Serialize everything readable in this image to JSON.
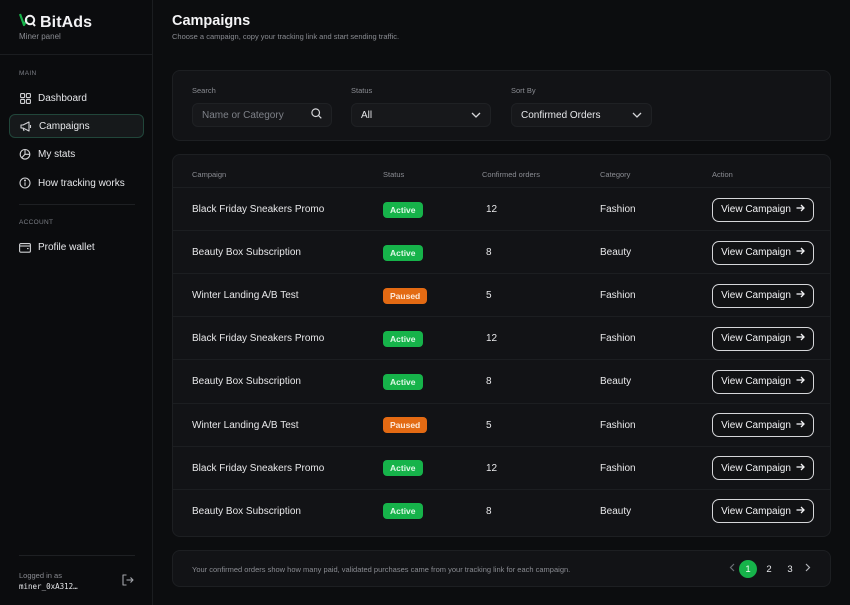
{
  "brand": {
    "name": "BitAds",
    "subtitle": "Miner panel"
  },
  "sidebar": {
    "main_label": "MAIN",
    "account_label": "ACCOUNT",
    "items": [
      {
        "label": "Dashboard",
        "icon": "grid-icon"
      },
      {
        "label": "Campaigns",
        "icon": "megaphone-icon",
        "active": true
      },
      {
        "label": "My stats",
        "icon": "pie-chart-icon"
      },
      {
        "label": "How tracking works",
        "icon": "info-icon"
      }
    ],
    "account_items": [
      {
        "label": "Profile wallet",
        "icon": "wallet-icon"
      }
    ],
    "logged_in_label": "Logged in as",
    "logged_in_user": "miner_0xA312…"
  },
  "page": {
    "title": "Campaigns",
    "subtitle": "Choose a campaign, copy your tracking link and start sending traffic."
  },
  "filters": {
    "search_label": "Search",
    "search_placeholder": "Name or Category",
    "status_label": "Status",
    "status_value": "All",
    "sort_label": "Sort By",
    "sort_value": "Confirmed Orders"
  },
  "table": {
    "headers": [
      "Campaign",
      "Status",
      "Confirmed orders",
      "Category",
      "Action"
    ],
    "rows": [
      {
        "campaign": "Black Friday Sneakers Promo",
        "status": "Active",
        "orders": "12",
        "category": "Fashion",
        "action": "View Campaign"
      },
      {
        "campaign": "Beauty Box Subscription",
        "status": "Active",
        "orders": "8",
        "category": "Beauty",
        "action": "View Campaign"
      },
      {
        "campaign": "Winter Landing A/B Test",
        "status": "Paused",
        "orders": "5",
        "category": "Fashion",
        "action": "View Campaign"
      },
      {
        "campaign": "Black Friday Sneakers Promo",
        "status": "Active",
        "orders": "12",
        "category": "Fashion",
        "action": "View Campaign"
      },
      {
        "campaign": "Beauty Box Subscription",
        "status": "Active",
        "orders": "8",
        "category": "Beauty",
        "action": "View Campaign"
      },
      {
        "campaign": "Winter Landing A/B Test",
        "status": "Paused",
        "orders": "5",
        "category": "Fashion",
        "action": "View Campaign"
      },
      {
        "campaign": "Black Friday Sneakers Promo",
        "status": "Active",
        "orders": "12",
        "category": "Fashion",
        "action": "View Campaign"
      },
      {
        "campaign": "Beauty Box Subscription",
        "status": "Active",
        "orders": "8",
        "category": "Beauty",
        "action": "View Campaign"
      }
    ]
  },
  "footer": {
    "note": "Your confirmed orders show how many paid, validated purchases came from your tracking link for each campaign.",
    "pages": [
      "1",
      "2",
      "3"
    ],
    "current_page": "1"
  },
  "colors": {
    "accent": "#16b34a",
    "paused": "#e36a13",
    "background": "#0c0d0f"
  }
}
